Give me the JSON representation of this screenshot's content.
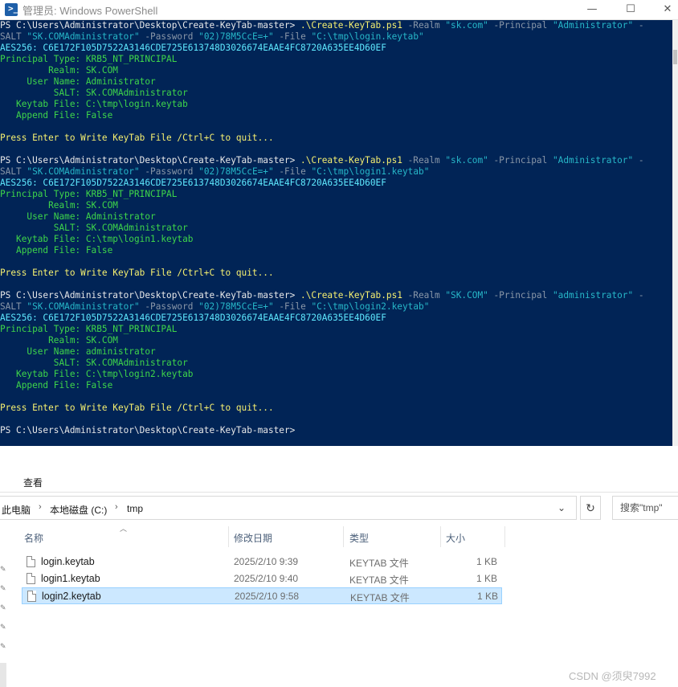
{
  "powershell": {
    "title": "管理员: Windows PowerShell",
    "buttons": {
      "minimize": "—",
      "maximize": "☐",
      "close": "✕"
    },
    "lines": [
      [
        [
          "PS C:\\Users\\Administrator\\Desktop\\Create-KeyTab-master> ",
          "w"
        ],
        [
          ".\\Create-KeyTab.ps1",
          "y"
        ],
        [
          " -Realm ",
          "g"
        ],
        [
          "\"sk.com\"",
          "s"
        ],
        [
          " -Principal ",
          "g"
        ],
        [
          "\"Administrator\"",
          "s"
        ],
        [
          " -",
          "g"
        ]
      ],
      [
        [
          "SALT ",
          "g"
        ],
        [
          "\"SK.COMAdministrator\"",
          "s"
        ],
        [
          " -Password ",
          "g"
        ],
        [
          "\"02)78M5CcE=+\"",
          "s"
        ],
        [
          " -File ",
          "g"
        ],
        [
          "\"C:\\tmp\\login.keytab\"",
          "s"
        ]
      ],
      [
        [
          "AES256: C6E172F105D7522A3146CDE725E613748D3026674EAAE4FC8720A635EE4D60EF",
          "c"
        ]
      ],
      [
        [
          "Principal Type: KRB5_NT_PRINCIPAL",
          "gr"
        ]
      ],
      [
        [
          "         Realm: SK.COM",
          "gr"
        ]
      ],
      [
        [
          "     User Name: Administrator",
          "gr"
        ]
      ],
      [
        [
          "          SALT: SK.COMAdministrator",
          "gr"
        ]
      ],
      [
        [
          "   Keytab File: C:\\tmp\\login.keytab",
          "gr"
        ]
      ],
      [
        [
          "   Append File: False",
          "gr"
        ]
      ],
      [
        [
          "",
          ""
        ]
      ],
      [
        [
          "Press Enter to Write KeyTab File /Ctrl+C to quit...",
          "y"
        ]
      ],
      [
        [
          "",
          ""
        ]
      ],
      [
        [
          "PS C:\\Users\\Administrator\\Desktop\\Create-KeyTab-master> ",
          "w"
        ],
        [
          ".\\Create-KeyTab.ps1",
          "y"
        ],
        [
          " -Realm ",
          "g"
        ],
        [
          "\"sk.com\"",
          "s"
        ],
        [
          " -Principal ",
          "g"
        ],
        [
          "\"Administrator\"",
          "s"
        ],
        [
          " -",
          "g"
        ]
      ],
      [
        [
          "SALT ",
          "g"
        ],
        [
          "\"SK.COMAdministrator\"",
          "s"
        ],
        [
          " -Password ",
          "g"
        ],
        [
          "\"02)78M5CcE=+\"",
          "s"
        ],
        [
          " -File ",
          "g"
        ],
        [
          "\"C:\\tmp\\login1.keytab\"",
          "s"
        ]
      ],
      [
        [
          "AES256: C6E172F105D7522A3146CDE725E613748D3026674EAAE4FC8720A635EE4D60EF",
          "c"
        ]
      ],
      [
        [
          "Principal Type: KRB5_NT_PRINCIPAL",
          "gr"
        ]
      ],
      [
        [
          "         Realm: SK.COM",
          "gr"
        ]
      ],
      [
        [
          "     User Name: Administrator",
          "gr"
        ]
      ],
      [
        [
          "          SALT: SK.COMAdministrator",
          "gr"
        ]
      ],
      [
        [
          "   Keytab File: C:\\tmp\\login1.keytab",
          "gr"
        ]
      ],
      [
        [
          "   Append File: False",
          "gr"
        ]
      ],
      [
        [
          "",
          ""
        ]
      ],
      [
        [
          "Press Enter to Write KeyTab File /Ctrl+C to quit...",
          "y"
        ]
      ],
      [
        [
          "",
          ""
        ]
      ],
      [
        [
          "PS C:\\Users\\Administrator\\Desktop\\Create-KeyTab-master> ",
          "w"
        ],
        [
          ".\\Create-KeyTab.ps1",
          "y"
        ],
        [
          " -Realm ",
          "g"
        ],
        [
          "\"SK.COM\"",
          "s"
        ],
        [
          " -Principal ",
          "g"
        ],
        [
          "\"administrator\"",
          "s"
        ],
        [
          " -",
          "g"
        ]
      ],
      [
        [
          "SALT ",
          "g"
        ],
        [
          "\"SK.COMAdministrator\"",
          "s"
        ],
        [
          " -Password ",
          "g"
        ],
        [
          "\"02)78M5CcE=+\"",
          "s"
        ],
        [
          " -File ",
          "g"
        ],
        [
          "\"C:\\tmp\\login2.keytab\"",
          "s"
        ]
      ],
      [
        [
          "AES256: C6E172F105D7522A3146CDE725E613748D3026674EAAE4FC8720A635EE4D60EF",
          "c"
        ]
      ],
      [
        [
          "Principal Type: KRB5_NT_PRINCIPAL",
          "gr"
        ]
      ],
      [
        [
          "         Realm: SK.COM",
          "gr"
        ]
      ],
      [
        [
          "     User Name: administrator",
          "gr"
        ]
      ],
      [
        [
          "          SALT: SK.COMAdministrator",
          "gr"
        ]
      ],
      [
        [
          "   Keytab File: C:\\tmp\\login2.keytab",
          "gr"
        ]
      ],
      [
        [
          "   Append File: False",
          "gr"
        ]
      ],
      [
        [
          "",
          ""
        ]
      ],
      [
        [
          "Press Enter to Write KeyTab File /Ctrl+C to quit...",
          "y"
        ]
      ],
      [
        [
          "",
          ""
        ]
      ],
      [
        [
          "PS C:\\Users\\Administrator\\Desktop\\Create-KeyTab-master>",
          "w"
        ]
      ]
    ]
  },
  "explorer": {
    "ribbon_tab": "查看",
    "breadcrumb": [
      "此电脑",
      "本地磁盘 (C:)",
      "tmp"
    ],
    "search_placeholder": "搜索\"tmp\"",
    "columns": {
      "name": "名称",
      "date": "修改日期",
      "type": "类型",
      "size": "大小"
    },
    "files": [
      {
        "name": "login.keytab",
        "date": "2025/2/10 9:39",
        "type": "KEYTAB 文件",
        "size": "1 KB"
      },
      {
        "name": "login1.keytab",
        "date": "2025/2/10 9:40",
        "type": "KEYTAB 文件",
        "size": "1 KB"
      },
      {
        "name": "login2.keytab",
        "date": "2025/2/10 9:58",
        "type": "KEYTAB 文件",
        "size": "1 KB"
      }
    ],
    "selected_index": 2
  },
  "watermark": "CSDN @须臾7992"
}
